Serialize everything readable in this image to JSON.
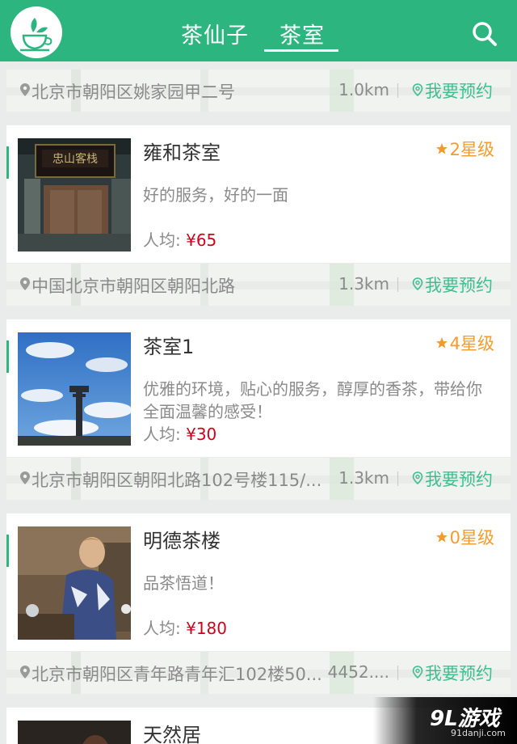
{
  "header": {
    "tabs": [
      {
        "label": "茶仙子",
        "active": false
      },
      {
        "label": "茶室",
        "active": true
      }
    ],
    "brand_color": "#2cb57f"
  },
  "top_address": {
    "address": "北京市朝阳区姚家园甲二号",
    "distance": "1.0km",
    "book_label": "我要预约"
  },
  "teahouses": [
    {
      "name": "雍和茶室",
      "rating": "2星级",
      "description": "好的服务，好的一面",
      "price_label": "人均:",
      "price": "¥65",
      "address": "中国北京市朝阳区朝阳北路",
      "distance": "1.3km",
      "book_label": "我要预约"
    },
    {
      "name": "茶室1",
      "rating": "4星级",
      "description": "优雅的环境，贴心的服务，醇厚的香茶，带给你全面温馨的感受！",
      "price_label": "人均:",
      "price": "¥30",
      "address": "北京市朝阳区朝阳北路102号楼115/...",
      "distance": "1.3km",
      "book_label": "我要预约"
    },
    {
      "name": "明德茶楼",
      "rating": "0星级",
      "description": "品茶悟道！",
      "price_label": "人均:",
      "price": "¥180",
      "address": "北京市朝阳区青年路青年汇102楼50...",
      "distance": "4452....",
      "book_label": "我要预约"
    },
    {
      "name": "天然居"
    }
  ],
  "watermark": {
    "logo": "9L游戏",
    "url": "91danji.com"
  },
  "colors": {
    "accent_green": "#3fbf8f",
    "star_orange": "#f39c2d",
    "price_red": "#d0021b"
  }
}
